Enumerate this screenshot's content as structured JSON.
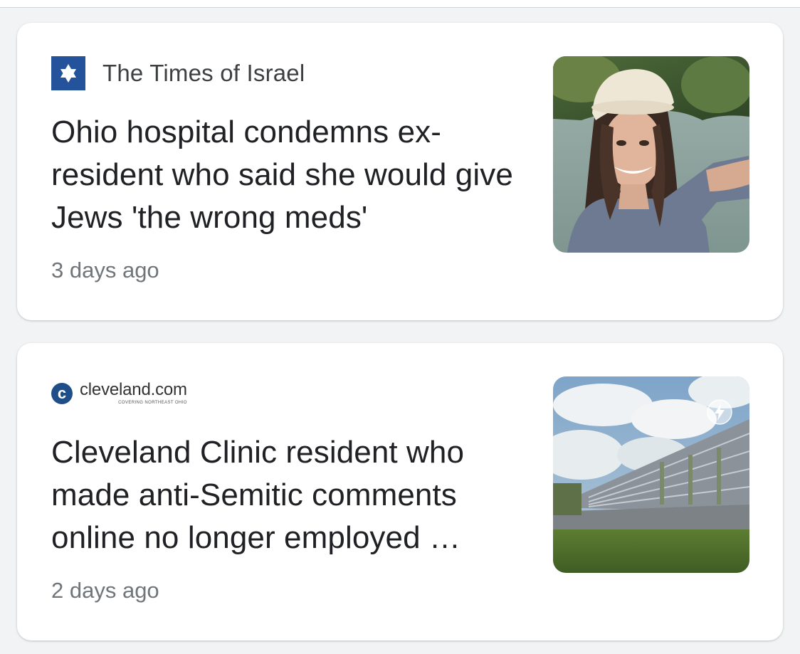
{
  "articles": [
    {
      "source": "The Times of Israel",
      "headline": "Ohio hospital condemns ex-resident who said she would give Jews 'the wrong meds'",
      "timestamp": "3 days ago",
      "thumbnail_icon": "woman-photo"
    },
    {
      "source": "cleveland.com",
      "source_tagline": "COVERING NORTHEAST OHIO",
      "source_logo_letter": "c",
      "headline": "Cleveland Clinic resident who made anti-Semitic comments online no longer employed …",
      "timestamp": "2 days ago",
      "thumbnail_icon": "building-photo",
      "badge_icon": "amp-lightning-icon"
    }
  ],
  "colors": {
    "toi_brand": "#24539b",
    "cleveland_brand": "#1f4e89",
    "headline": "#202124",
    "meta": "#70757a"
  }
}
